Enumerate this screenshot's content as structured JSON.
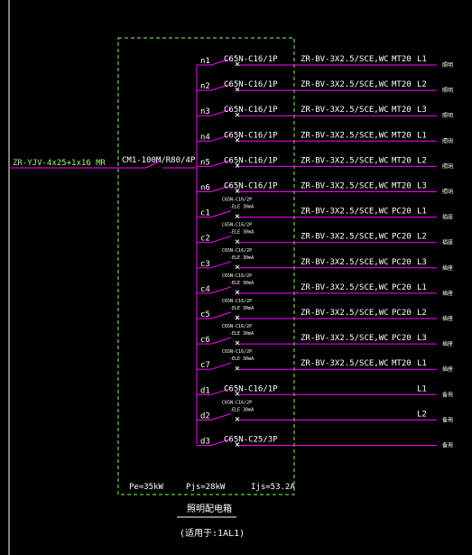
{
  "incoming": {
    "cable": "ZR-YJV-4x25+1x16 MR",
    "main_breaker": "CM1-100M/R80/4P"
  },
  "circuits": [
    {
      "id": "n1",
      "breaker": "C65N-C16/1P",
      "rcd": false,
      "cable": "ZR-BV-3X2.5/SCE,WC",
      "conduit": "MT20",
      "phase": "L1",
      "use": "照明"
    },
    {
      "id": "n2",
      "breaker": "C65N-C16/1P",
      "rcd": false,
      "cable": "ZR-BV-3X2.5/SCE,WC",
      "conduit": "MT20",
      "phase": "L2",
      "use": "照明"
    },
    {
      "id": "n3",
      "breaker": "C65N-C16/1P",
      "rcd": false,
      "cable": "ZR-BV-3X2.5/SCE,WC",
      "conduit": "MT20",
      "phase": "L3",
      "use": "照明"
    },
    {
      "id": "n4",
      "breaker": "C65N-C16/1P",
      "rcd": false,
      "cable": "ZR-BV-3X2.5/SCE,WC",
      "conduit": "MT20",
      "phase": "L1",
      "use": "照明"
    },
    {
      "id": "n5",
      "breaker": "C65N-C16/1P",
      "rcd": false,
      "cable": "ZR-BV-3X2.5/SCE,WC",
      "conduit": "MT20",
      "phase": "L2",
      "use": "照明"
    },
    {
      "id": "n6",
      "breaker": "C65N-C16/1P",
      "rcd": false,
      "cable": "ZR-BV-3X2.5/SCE,WC",
      "conduit": "MT20",
      "phase": "L3",
      "use": "照明"
    },
    {
      "id": "c1",
      "breaker": "C65N-C16/2P",
      "rcd": true,
      "rcd_label": "-ELE 30mA",
      "cable": "ZR-BV-3X2.5/SCE,WC",
      "conduit": "PC20",
      "phase": "L1",
      "use": "插座"
    },
    {
      "id": "c2",
      "breaker": "C65N-C16/2P",
      "rcd": true,
      "rcd_label": "-ELE 30mA",
      "cable": "ZR-BV-3X2.5/SCE,WC",
      "conduit": "PC20",
      "phase": "L2",
      "use": "插座"
    },
    {
      "id": "c3",
      "breaker": "C65N-C16/2P",
      "rcd": true,
      "rcd_label": "-ELE 30mA",
      "cable": "ZR-BV-3X2.5/SCE,WC",
      "conduit": "PC20",
      "phase": "L3",
      "use": "插座"
    },
    {
      "id": "c4",
      "breaker": "C65N-C16/2P",
      "rcd": true,
      "rcd_label": "-ELE 30mA",
      "cable": "ZR-BV-3X2.5/SCE,WC",
      "conduit": "PC20",
      "phase": "L1",
      "use": "插座"
    },
    {
      "id": "c5",
      "breaker": "C65N-C16/2P",
      "rcd": true,
      "rcd_label": "-ELE 30mA",
      "cable": "ZR-BV-3X2.5/SCE,WC",
      "conduit": "PC20",
      "phase": "L2",
      "use": "插座"
    },
    {
      "id": "c6",
      "breaker": "C65N-C16/2P",
      "rcd": true,
      "rcd_label": "-ELE 30mA",
      "cable": "ZR-BV-3X2.5/SCE,WC",
      "conduit": "PC20",
      "phase": "L3",
      "use": "插座"
    },
    {
      "id": "c7",
      "breaker": "C65N-C16/2P",
      "rcd": true,
      "rcd_label": "-ELE 30mA",
      "cable": "ZR-BV-3X2.5/SCE,WC",
      "conduit": "MT20",
      "phase": "L1",
      "use": "插座"
    },
    {
      "id": "d1",
      "breaker": "C65N-C16/1P",
      "rcd": false,
      "cable": "",
      "conduit": "",
      "phase": "L1",
      "use": "备用"
    },
    {
      "id": "d2",
      "breaker": "C65N-C16/2P",
      "rcd": true,
      "rcd_label": "-ELE 30mA",
      "cable": "",
      "conduit": "",
      "phase": "L2",
      "use": "备用"
    },
    {
      "id": "d3",
      "breaker": "C65N-C25/3P",
      "rcd": false,
      "cable": "",
      "conduit": "",
      "phase": "",
      "use": "备用"
    }
  ],
  "footer": {
    "pe": "Pe=35kW",
    "pjs": "Pjs=28kW",
    "ijs": "Ijs=53.2A"
  },
  "panel": {
    "title": "照明配电箱",
    "subtitle": "(适用于:1AL1)"
  },
  "colors": {
    "background": "#000000",
    "wire": "#ff00ff",
    "box_dash": "#7cff5a",
    "text": "#ffffff",
    "incoming_text": "#9dff6a"
  }
}
